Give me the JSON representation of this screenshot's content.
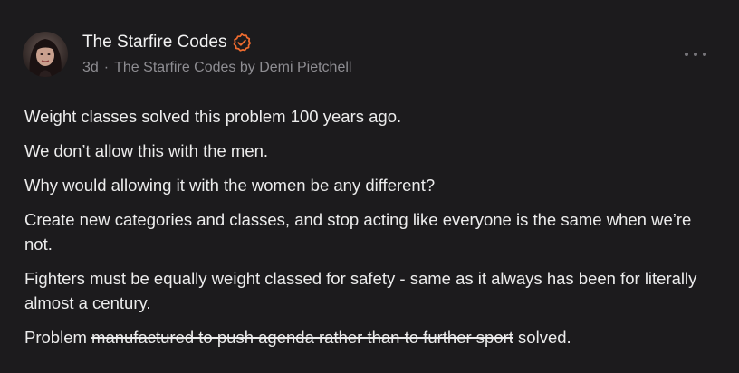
{
  "post": {
    "author_name": "The Starfire Codes",
    "time_ago": "3d",
    "separator": "·",
    "publication": "The Starfire Codes by Demi Pietchell",
    "avatar_icon": "avatar-photo",
    "verified_icon": "verified-badge-icon",
    "more_icon": "ellipsis-icon",
    "accent_color": "#ef6c2f"
  },
  "content": {
    "p1": "Weight classes solved this problem 100 years ago.",
    "p2": "We don’t allow this with the men.",
    "p3": "Why would allowing it with the women be any different?",
    "p4": "Create new categories and classes, and stop acting like everyone is the same when we’re not.",
    "p5": "Fighters must be equally weight classed for safety - same as it always has been for literally almost a century.",
    "p6_start": "Problem ",
    "p6_strike": "manufactured to push agenda rather than to further sport",
    "p6_end": " solved."
  }
}
